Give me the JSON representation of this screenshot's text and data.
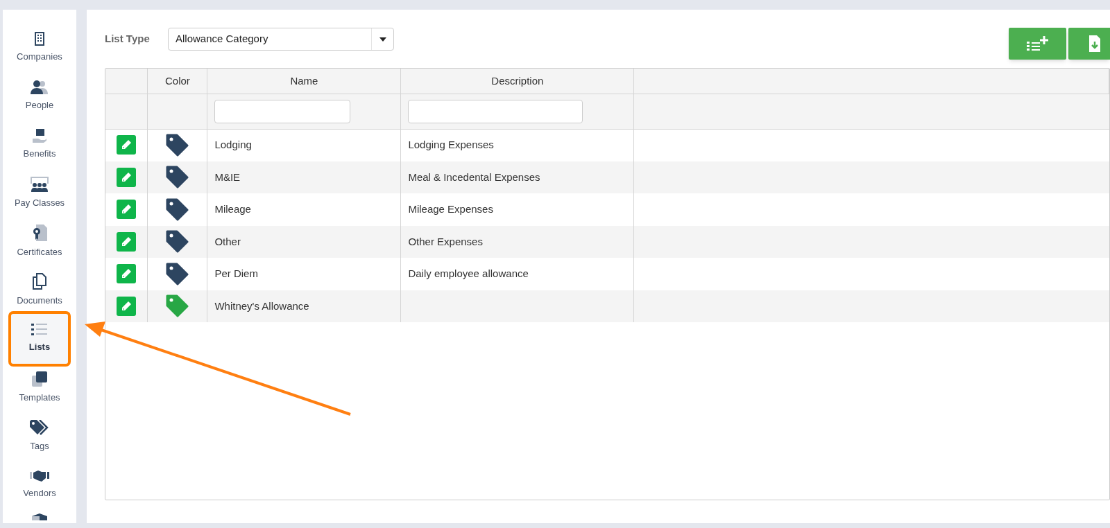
{
  "sidebar": {
    "items": [
      {
        "label": "Companies",
        "selected": false
      },
      {
        "label": "People",
        "selected": false
      },
      {
        "label": "Benefits",
        "selected": false
      },
      {
        "label": "Pay Classes",
        "selected": false
      },
      {
        "label": "Certificates",
        "selected": false
      },
      {
        "label": "Documents",
        "selected": false
      },
      {
        "label": "Lists",
        "selected": true
      },
      {
        "label": "Templates",
        "selected": false
      },
      {
        "label": "Tags",
        "selected": false
      },
      {
        "label": "Vendors",
        "selected": false
      }
    ]
  },
  "list_type": {
    "label": "List Type",
    "value": "Allowance Category"
  },
  "table": {
    "columns": [
      "",
      "Color",
      "Name",
      "Description",
      ""
    ],
    "rows": [
      {
        "color": "#2d4560",
        "name": "Lodging",
        "description": "Lodging Expenses"
      },
      {
        "color": "#2d4560",
        "name": "M&IE",
        "description": "Meal & Incedental Expenses"
      },
      {
        "color": "#2d4560",
        "name": "Mileage",
        "description": "Mileage Expenses"
      },
      {
        "color": "#2d4560",
        "name": "Other",
        "description": "Other Expenses"
      },
      {
        "color": "#2d4560",
        "name": "Per Diem",
        "description": "Daily employee allowance"
      },
      {
        "color": "#28a745",
        "name": "Whitney's Allowance",
        "description": ""
      }
    ]
  }
}
